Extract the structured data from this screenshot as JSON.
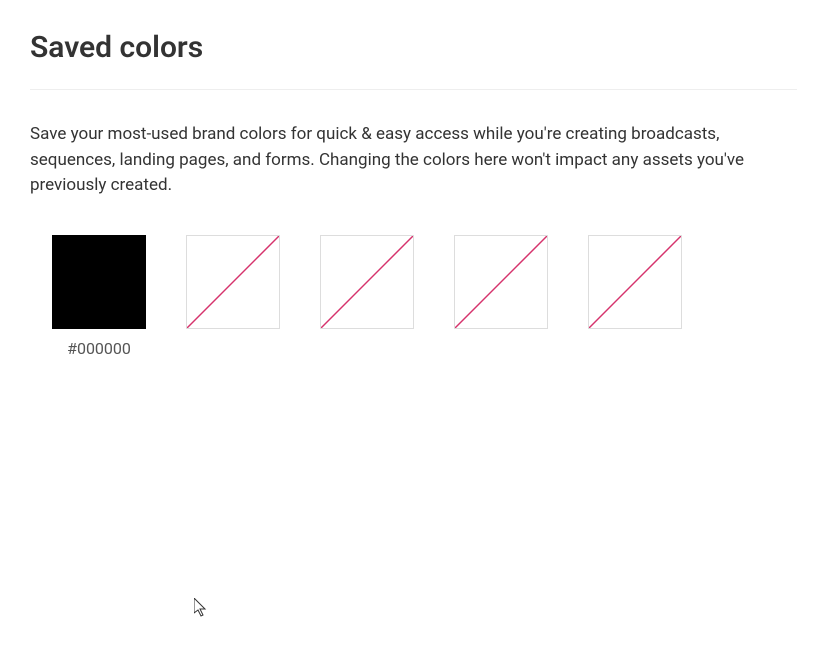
{
  "page": {
    "title": "Saved colors",
    "description": "Save your most-used brand colors for quick & easy access while you're creating broadcasts, sequences, landing pages, and forms. Changing the colors here won't impact any assets you've previously created."
  },
  "swatches": [
    {
      "empty": false,
      "color": "#000000",
      "label": "#000000"
    },
    {
      "empty": true,
      "color": null,
      "label": ""
    },
    {
      "empty": true,
      "color": null,
      "label": ""
    },
    {
      "empty": true,
      "color": null,
      "label": ""
    },
    {
      "empty": true,
      "color": null,
      "label": ""
    }
  ],
  "colors": {
    "diagonal_stroke": "#d6336c"
  }
}
